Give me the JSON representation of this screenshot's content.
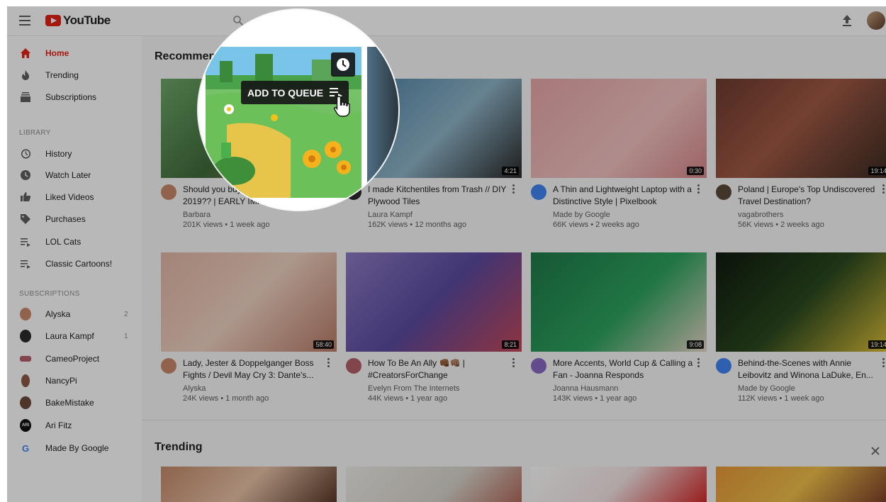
{
  "header": {
    "logo_text": "YouTube"
  },
  "sidebar": {
    "main_items": [
      {
        "label": "Home",
        "icon": "home-icon"
      },
      {
        "label": "Trending",
        "icon": "flame-icon"
      },
      {
        "label": "Subscriptions",
        "icon": "subscriptions-icon"
      }
    ],
    "library_heading": "LIBRARY",
    "library_items": [
      {
        "label": "History",
        "icon": "history-icon"
      },
      {
        "label": "Watch Later",
        "icon": "clock-icon"
      },
      {
        "label": "Liked Videos",
        "icon": "thumbs-up-icon"
      },
      {
        "label": "Purchases",
        "icon": "tag-icon"
      },
      {
        "label": "LOL Cats",
        "icon": "playlist-icon"
      },
      {
        "label": "Classic Cartoons!",
        "icon": "playlist-icon"
      }
    ],
    "subscriptions_heading": "SUBSCRIPTIONS",
    "subscription_items": [
      {
        "label": "Alyska",
        "count": "2",
        "color": "#c98a6a"
      },
      {
        "label": "Laura Kampf",
        "count": "1",
        "color": "#2b2b2b"
      },
      {
        "label": "CameoProject",
        "count": "",
        "color": "#b6606a"
      },
      {
        "label": "NancyPi",
        "count": "",
        "color": "#8b5a44"
      },
      {
        "label": "BakeMistake",
        "count": "",
        "color": "#6b4a3a"
      },
      {
        "label": "Ari Fitz",
        "count": "",
        "color": "#111111",
        "initials": "ARI"
      },
      {
        "label": "Made By Google",
        "count": "",
        "color": "#4285f4",
        "initials": "G"
      }
    ]
  },
  "main": {
    "recommended_title": "Recommended",
    "trending_title": "Trending",
    "videos": [
      {
        "title": "Should you buy a Nintendo Switch in 2019?? | EARLY IMPRESSIONS of...",
        "channel": "Barbara",
        "meta": "201K views • 1 week ago",
        "duration": "",
        "thumb": "linear-gradient(135deg,#6fa86a,#3f6b3a 50%,#c9824f)",
        "avatar": "#c98a6a"
      },
      {
        "title": "I made Kitchentiles from Trash // DIY Plywood Tiles",
        "channel": "Laura Kampf",
        "meta": "162K views • 12 months ago",
        "duration": "4:21",
        "thumb": "linear-gradient(135deg,#4a7fa3,#8fb5c9 55%,#2a2a2a)",
        "avatar": "#2b2b2b"
      },
      {
        "title": "A Thin and Lightweight Laptop with a Distinctive Style | Pixelbook",
        "channel": "Made by Google",
        "meta": "66K views • 2 weeks ago",
        "duration": "0:30",
        "thumb": "linear-gradient(135deg,#e9a7a9,#f3c3c2 60%,#d9898c)",
        "avatar": "#4285f4"
      },
      {
        "title": "Poland | Europe's Top Undiscovered Travel Destination?",
        "channel": "vagabrothers",
        "meta": "56K views • 2 weeks ago",
        "duration": "19:14",
        "thumb": "linear-gradient(135deg,#6e3b2e,#a15a45 45%,#3b2a22)",
        "avatar": "#5a4a3a"
      },
      {
        "title": "Lady, Jester & Doppelganger Boss Fights / Devil May Cry 3: Dante's...",
        "channel": "Alyska",
        "meta": "24K views • 1 month ago",
        "duration": "58:40",
        "thumb": "linear-gradient(135deg,#e3b7a6,#f0d2c2 50%,#b97d68)",
        "avatar": "#c98a6a"
      },
      {
        "title": "How To Be An Ally 👊🏾👊🏽 | #CreatorsForChange",
        "channel": "Evelyn From The Internets",
        "meta": "44K views • 1 year ago",
        "duration": "8:21",
        "thumb": "linear-gradient(135deg,#8d7bc4,#5b4aa0 50%,#c4475a)",
        "avatar": "#b6606a"
      },
      {
        "title": "More Accents, World Cup & Calling a Fan - Joanna Responds",
        "channel": "Joanna Hausmann",
        "meta": "143K views • 1 year ago",
        "duration": "9:08",
        "thumb": "linear-gradient(135deg,#1f7a4a,#2da35f 55%,#e8d8c8)",
        "avatar": "#8a6ac4"
      },
      {
        "title": "Behind-the-Scenes with Annie Leibovitz and Winona LaDuke, En...",
        "channel": "Made by Google",
        "meta": "112K views • 1 week ago",
        "duration": "19:14",
        "thumb": "linear-gradient(135deg,#0f1a0f,#2b4a1f 50%,#e0c23a)",
        "avatar": "#4285f4"
      }
    ],
    "trending_thumbs": [
      "linear-gradient(135deg,#c58a6a,#e9c3a8 50%,#5a3a2a)",
      "linear-gradient(135deg,#f0eee9,#d9d4cc 60%,#b36b5a)",
      "linear-gradient(135deg,#ffffff,#f5e6e6 50%,#d42a2a)",
      "linear-gradient(135deg,#e89a3a,#f0c04a 50%,#7a3a2a)"
    ]
  },
  "magnifier": {
    "add_to_queue_label": "ADD TO QUEUE"
  }
}
